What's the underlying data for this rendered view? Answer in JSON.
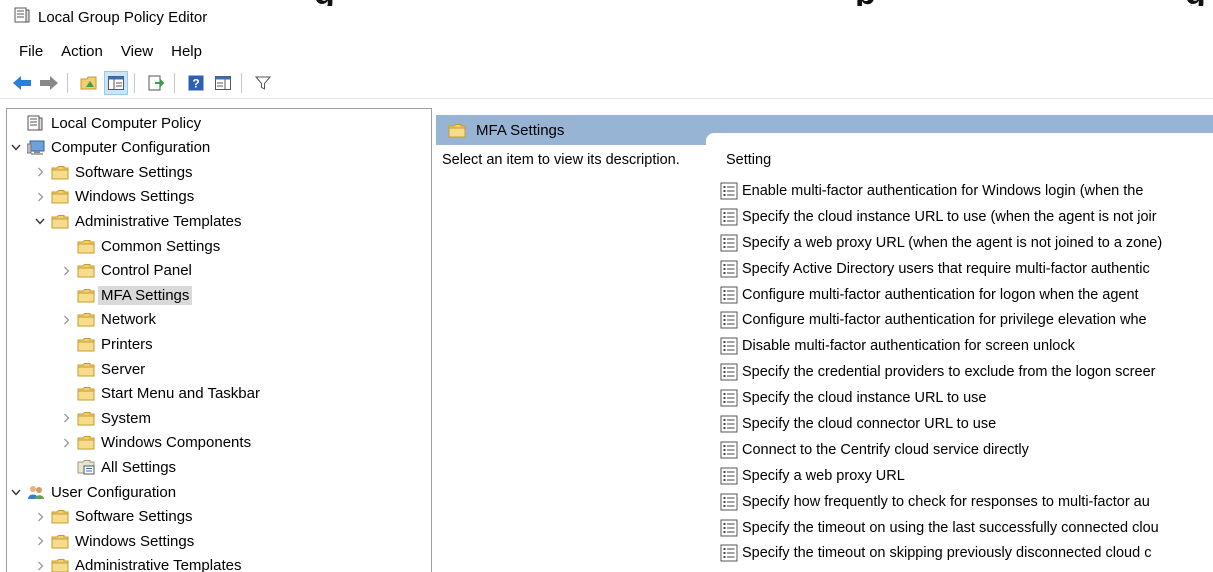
{
  "banner": {
    "partial_1": "g",
    "partial_2": "p",
    "partial_3": "g"
  },
  "window": {
    "title": "Local Group Policy Editor"
  },
  "menu": [
    "File",
    "Action",
    "View",
    "Help"
  ],
  "toolbar": {
    "buttons": [
      "back-arrow-icon",
      "forward-arrow-icon",
      "up-folder-icon",
      "show-hide-tree-icon",
      "export-list-icon",
      "help-icon",
      "extended-view-icon",
      "filter-icon"
    ]
  },
  "tree": {
    "items": [
      {
        "label": "Local Computer Policy",
        "level": 0,
        "expand": "none",
        "icon": "policy"
      },
      {
        "label": "Computer Configuration",
        "level": 0,
        "expand": "open",
        "icon": "computer"
      },
      {
        "label": "Software Settings",
        "level": 1,
        "expand": "closed",
        "icon": "folder"
      },
      {
        "label": "Windows Settings",
        "level": 1,
        "expand": "closed",
        "icon": "folder"
      },
      {
        "label": "Administrative Templates",
        "level": 1,
        "expand": "open",
        "icon": "folder"
      },
      {
        "label": "Common Settings",
        "level": 2,
        "expand": "none",
        "icon": "folder"
      },
      {
        "label": "Control Panel",
        "level": 2,
        "expand": "closed",
        "icon": "folder"
      },
      {
        "label": "MFA Settings",
        "level": 2,
        "expand": "none",
        "icon": "folder",
        "selected": true
      },
      {
        "label": "Network",
        "level": 2,
        "expand": "closed",
        "icon": "folder"
      },
      {
        "label": "Printers",
        "level": 2,
        "expand": "none",
        "icon": "folder"
      },
      {
        "label": "Server",
        "level": 2,
        "expand": "none",
        "icon": "folder"
      },
      {
        "label": "Start Menu and Taskbar",
        "level": 2,
        "expand": "none",
        "icon": "folder"
      },
      {
        "label": "System",
        "level": 2,
        "expand": "closed",
        "icon": "folder"
      },
      {
        "label": "Windows Components",
        "level": 2,
        "expand": "closed",
        "icon": "folder"
      },
      {
        "label": "All Settings",
        "level": 2,
        "expand": "none",
        "icon": "allsettings"
      },
      {
        "label": "User Configuration",
        "level": 0,
        "expand": "open",
        "icon": "users"
      },
      {
        "label": "Software Settings",
        "level": 1,
        "expand": "closed",
        "icon": "folder"
      },
      {
        "label": "Windows Settings",
        "level": 1,
        "expand": "closed",
        "icon": "folder"
      },
      {
        "label": "Administrative Templates",
        "level": 1,
        "expand": "closed",
        "icon": "folder"
      }
    ]
  },
  "right": {
    "header": "MFA Settings",
    "description": "Select an item to view its description.",
    "column": "Setting",
    "settings": [
      "Enable multi-factor authentication for Windows login (when the",
      "Specify the cloud instance URL to use (when the agent is not joir",
      "Specify a web proxy URL (when the agent is not joined to a zone)",
      "Specify Active Directory users that require multi-factor authentic",
      "Configure multi-factor authentication for logon when the agent",
      "Configure multi-factor authentication for privilege elevation whe",
      "Disable multi-factor authentication for screen unlock",
      "Specify the credential providers to exclude from the logon screer",
      "Specify the cloud instance URL to use",
      "Specify the cloud connector URL to use",
      "Connect to the Centrify cloud service directly",
      "Specify a web proxy URL",
      "Specify how frequently to check for responses to multi-factor au",
      "Specify the timeout on using the last successfully connected clou",
      "Specify the timeout on skipping previously disconnected cloud c"
    ]
  },
  "colors": {
    "header_bg": "#97b4d4",
    "selection_bg": "#d9d9d9",
    "folder": "#f2cf72",
    "border": "#a0a0a0"
  }
}
